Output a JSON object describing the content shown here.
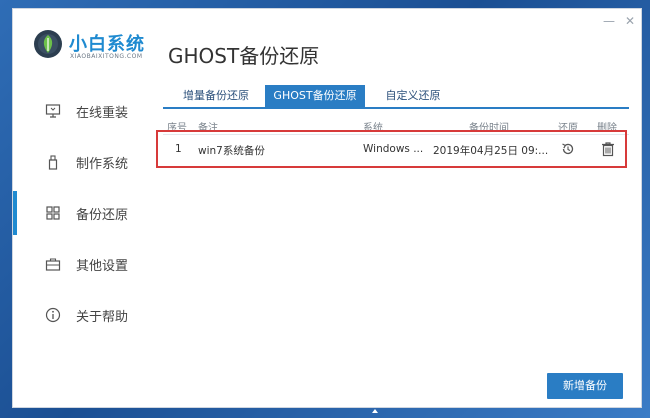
{
  "header": {
    "brand": "小白系统",
    "brand_sub": "XIAOBAIXITONG.COM",
    "page_title": "GHOST备份还原"
  },
  "window_controls": {
    "minimize": "—",
    "close": "✕"
  },
  "sidebar": {
    "items": [
      {
        "label": "在线重装",
        "icon": "monitor-icon"
      },
      {
        "label": "制作系统",
        "icon": "usb-icon"
      },
      {
        "label": "备份还原",
        "icon": "grid-icon",
        "active": true
      },
      {
        "label": "其他设置",
        "icon": "toolbox-icon"
      },
      {
        "label": "关于帮助",
        "icon": "info-icon"
      }
    ]
  },
  "tabs": [
    {
      "label": "增量备份还原"
    },
    {
      "label": "GHOST备份还原",
      "active": true
    },
    {
      "label": "自定义还原"
    }
  ],
  "table": {
    "headers": [
      "序号",
      "备注",
      "系统",
      "备份时间",
      "还原",
      "删除"
    ],
    "rows": [
      {
        "index": "1",
        "note": "win7系统备份",
        "system": "Windows ...",
        "time": "2019年04月25日 09:..."
      }
    ]
  },
  "add_backup_button": "新增备份",
  "colors": {
    "accent": "#2a7dc4",
    "highlight": "#d73a3a",
    "brand": "#1f8ad0"
  }
}
